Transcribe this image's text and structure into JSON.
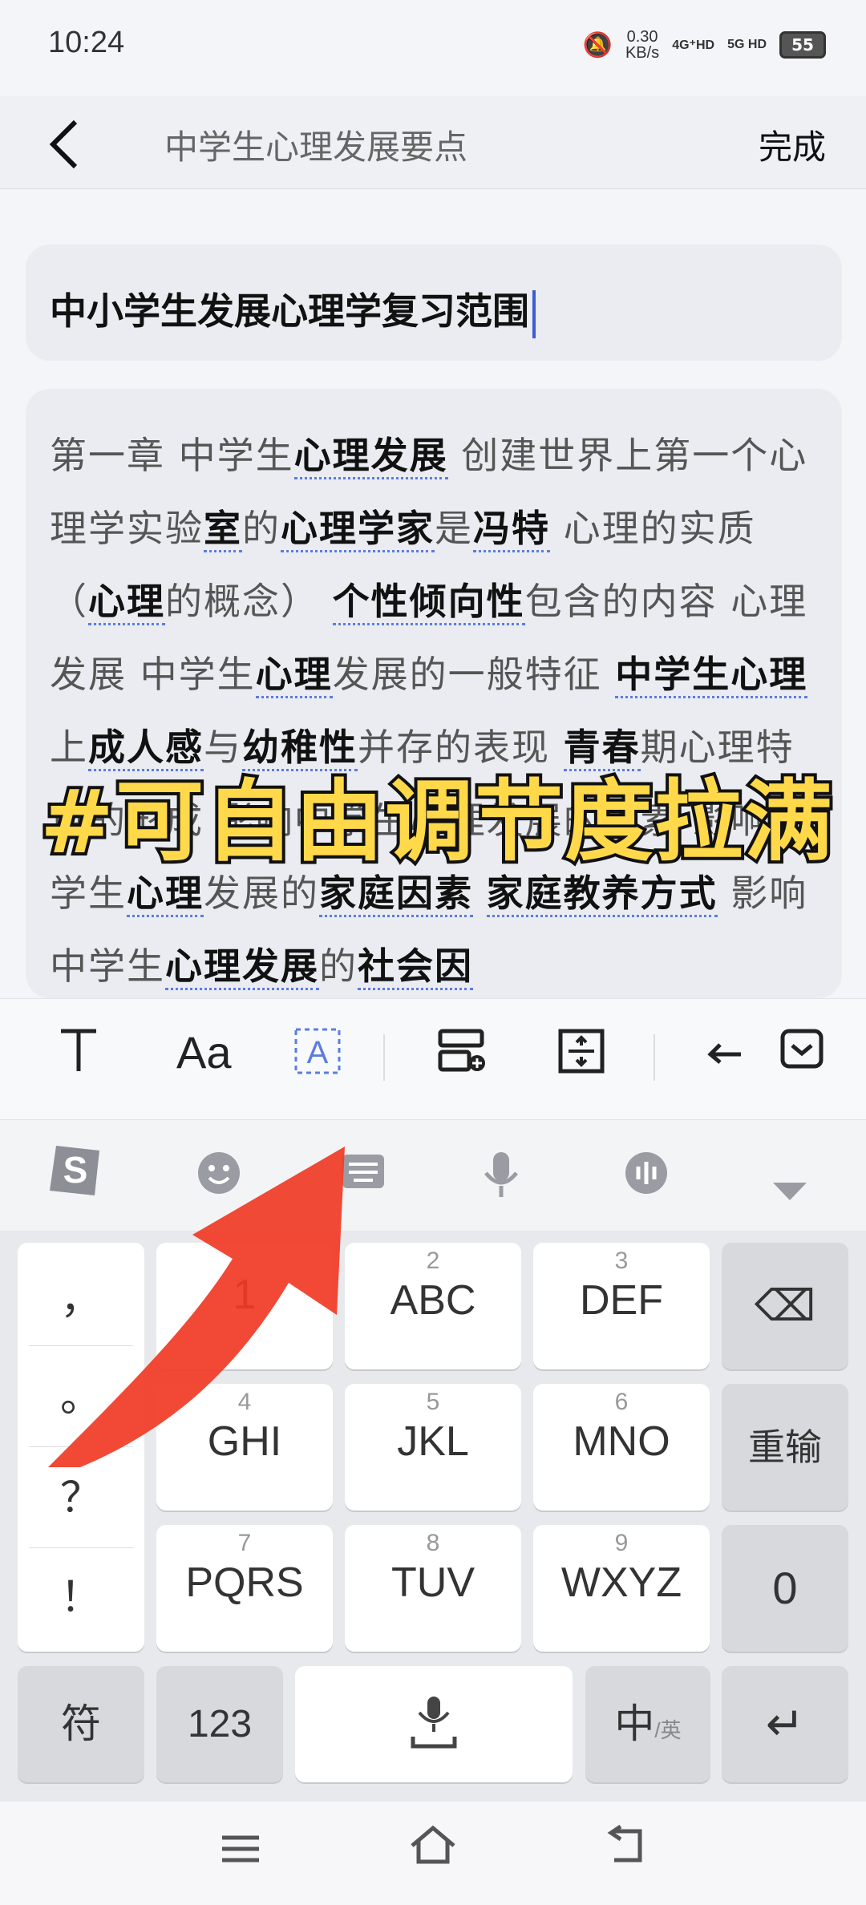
{
  "status": {
    "time": "10:24",
    "speed_value": "0.30",
    "speed_unit": "KB/s",
    "sim1": "4G⁺HD",
    "sim2": "5G HD",
    "battery": "55"
  },
  "header": {
    "title": "中学生心理发展要点",
    "done_label": "完成"
  },
  "note": {
    "title": "中小学生发展心理学复习范围",
    "body": [
      {
        "t": "第一章 中学生"
      },
      {
        "t": "心理发展",
        "k": true
      },
      {
        "t": " 创建世界上第一个心理学实验"
      },
      {
        "t": "室",
        "k": true
      },
      {
        "t": "的"
      },
      {
        "t": "心理学家",
        "k": true
      },
      {
        "t": "是"
      },
      {
        "t": "冯特",
        "k": true
      },
      {
        "t": " 心理的实质（"
      },
      {
        "t": "心理",
        "k": true
      },
      {
        "t": "的概念） "
      },
      {
        "t": "个性倾向性",
        "k": true
      },
      {
        "t": "包含的内容 心理发展 中学生"
      },
      {
        "t": "心理",
        "k": true
      },
      {
        "t": "发展的一般特征 "
      },
      {
        "t": "中学生心理",
        "k": true
      },
      {
        "t": "上"
      },
      {
        "t": "成人感",
        "k": true
      },
      {
        "t": "与"
      },
      {
        "t": "幼稚性",
        "k": true
      },
      {
        "t": "并存的表现 "
      },
      {
        "t": "青春",
        "k": true
      },
      {
        "t": "期心理特点的形成 影响中学生心理发展"
      },
      {
        "t": "的因素 影响中学生"
      },
      {
        "t": "心理",
        "k": true
      },
      {
        "t": "发展的"
      },
      {
        "t": "家庭因素",
        "k": true
      },
      {
        "t": " "
      },
      {
        "t": "家庭教养方式",
        "k": true
      },
      {
        "t": " 影响中学生"
      },
      {
        "t": "心理发展",
        "k": true
      },
      {
        "t": "的"
      },
      {
        "t": "社会因",
        "k": true
      }
    ]
  },
  "overlay_text": "#可自由调节度拉满",
  "toolbar": {
    "icons": [
      "text-style-icon",
      "font-size-icon",
      "text-box-icon",
      "insert-row-icon",
      "spacing-icon",
      "undo-icon",
      "collapse-icon"
    ]
  },
  "keyboard": {
    "top_icons": [
      "sogou-logo-icon",
      "emoji-icon",
      "keyboard-icon",
      "mic-icon",
      "translate-icon",
      "hide-keyboard-icon"
    ],
    "punct": [
      "，",
      "。",
      "？",
      "！"
    ],
    "keys": [
      {
        "num": "1",
        "label": ""
      },
      {
        "num": "2",
        "label": "ABC"
      },
      {
        "num": "3",
        "label": "DEF"
      },
      {
        "num": "4",
        "label": "GHI"
      },
      {
        "num": "5",
        "label": "JKL"
      },
      {
        "num": "6",
        "label": "MNO"
      },
      {
        "num": "7",
        "label": "PQRS"
      },
      {
        "num": "8",
        "label": "TUV"
      },
      {
        "num": "9",
        "label": "WXYZ"
      }
    ],
    "backspace": "⌫",
    "reinput": "重输",
    "zero": "0",
    "symbols": "符",
    "num123": "123",
    "lang": "中",
    "lang_sub": "/英",
    "enter": "↵"
  }
}
